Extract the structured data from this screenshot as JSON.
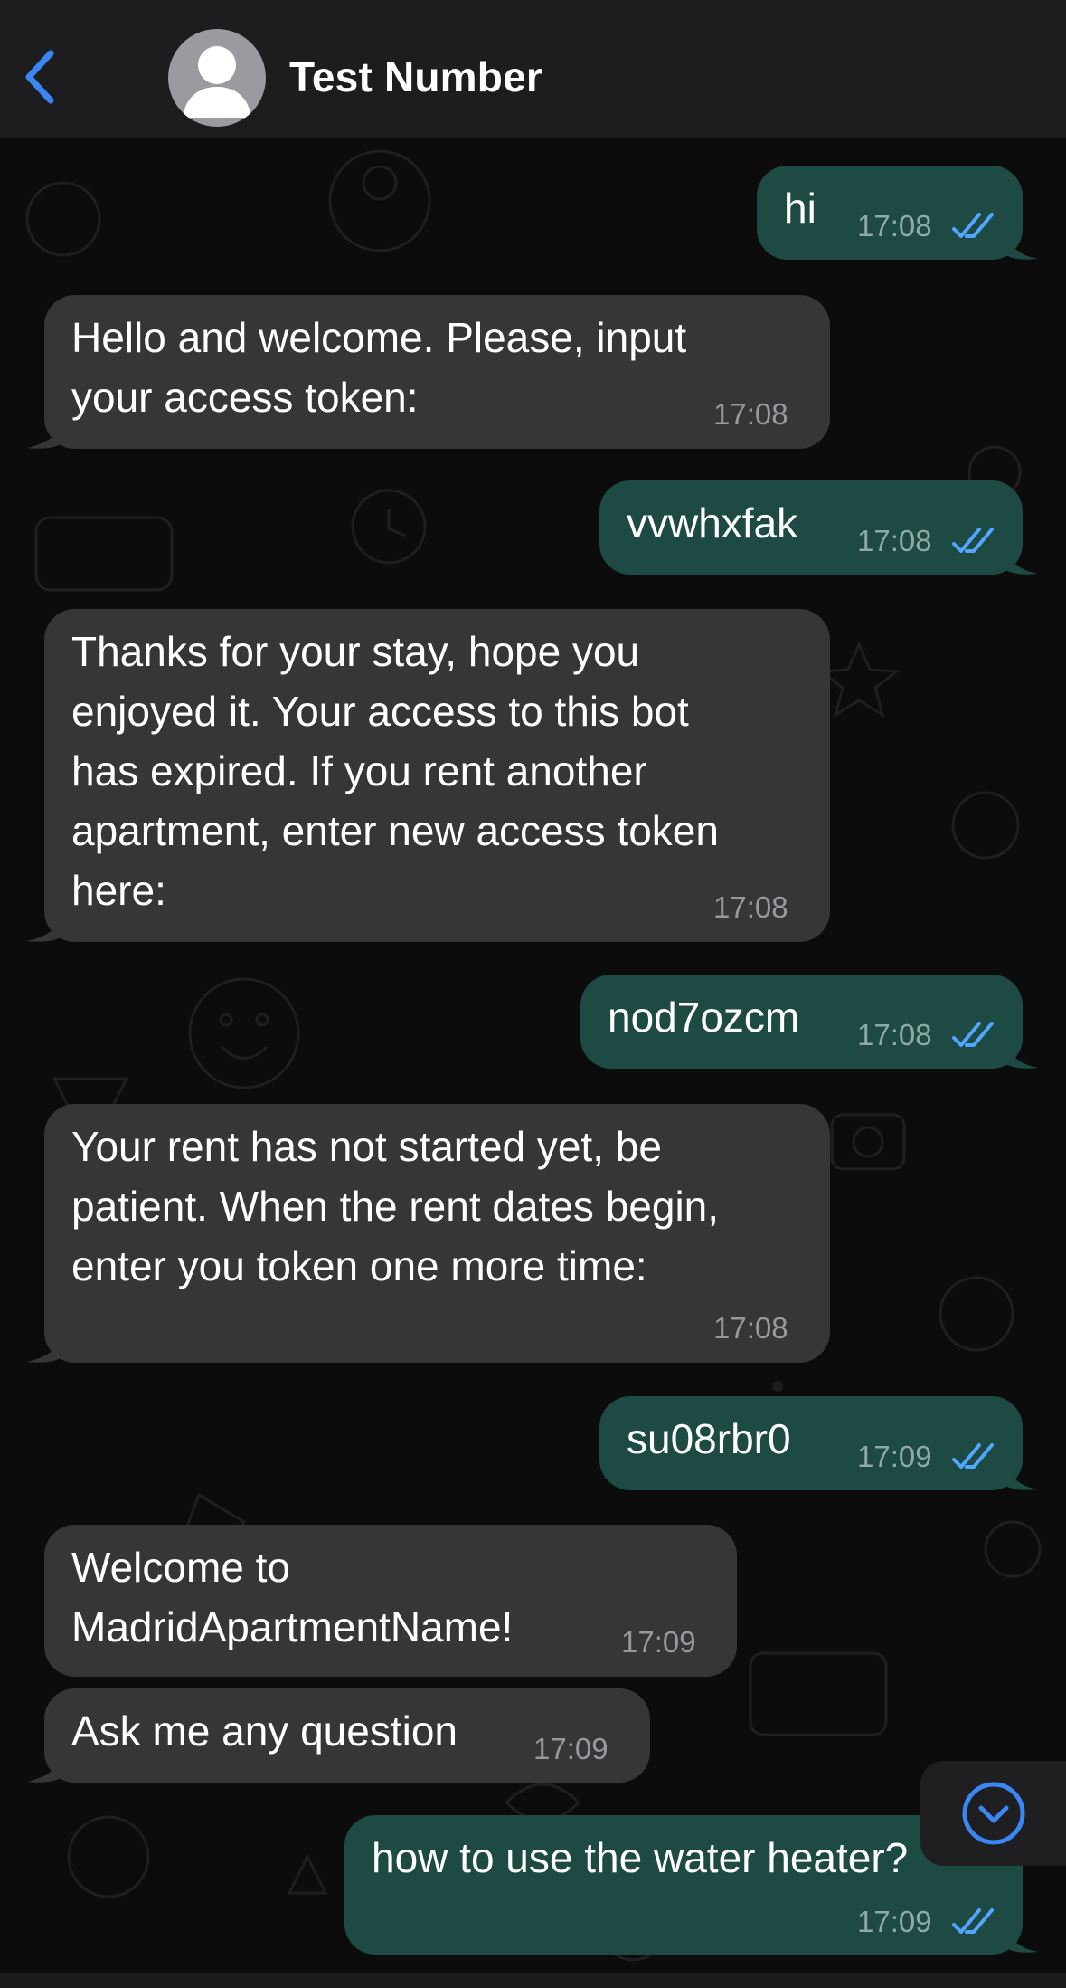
{
  "header": {
    "contact_name": "Test Number",
    "back_icon": "chevron-left-icon",
    "accent_color": "#3a86f5"
  },
  "messages": [
    {
      "direction": "outgoing",
      "text": "hi",
      "time": "17:08",
      "status": "read"
    },
    {
      "direction": "incoming",
      "text": "Hello and welcome. Please, input\nyour access token:",
      "time": "17:08"
    },
    {
      "direction": "outgoing",
      "text": "vvwhxfak",
      "time": "17:08",
      "status": "read"
    },
    {
      "direction": "incoming",
      "text": "Thanks for your stay, hope you\nenjoyed it. Your access to this bot\nhas expired. If you rent another\napartment, enter new access token\nhere:",
      "time": "17:08"
    },
    {
      "direction": "outgoing",
      "text": "nod7ozcm",
      "time": "17:08",
      "status": "read"
    },
    {
      "direction": "incoming",
      "text": "Your rent has not started yet, be\npatient. When the rent dates begin,\nenter you token one more time:",
      "time": "17:08"
    },
    {
      "direction": "outgoing",
      "text": "su08rbr0",
      "time": "17:09",
      "status": "read"
    },
    {
      "direction": "incoming",
      "text": "Welcome to\nMadridApartmentName!",
      "time": "17:09"
    },
    {
      "direction": "incoming",
      "text": "Ask me any question",
      "time": "17:09"
    },
    {
      "direction": "outgoing",
      "text": "how to use the water heater?",
      "time": "17:09",
      "status": "read"
    }
  ],
  "colors": {
    "incoming_bubble": "#363638",
    "outgoing_bubble": "#1d4a42",
    "read_ticks": "#53a6ff",
    "header_bg": "#1d1d1f"
  },
  "scroll_button_icon": "chevron-down-circle-icon"
}
